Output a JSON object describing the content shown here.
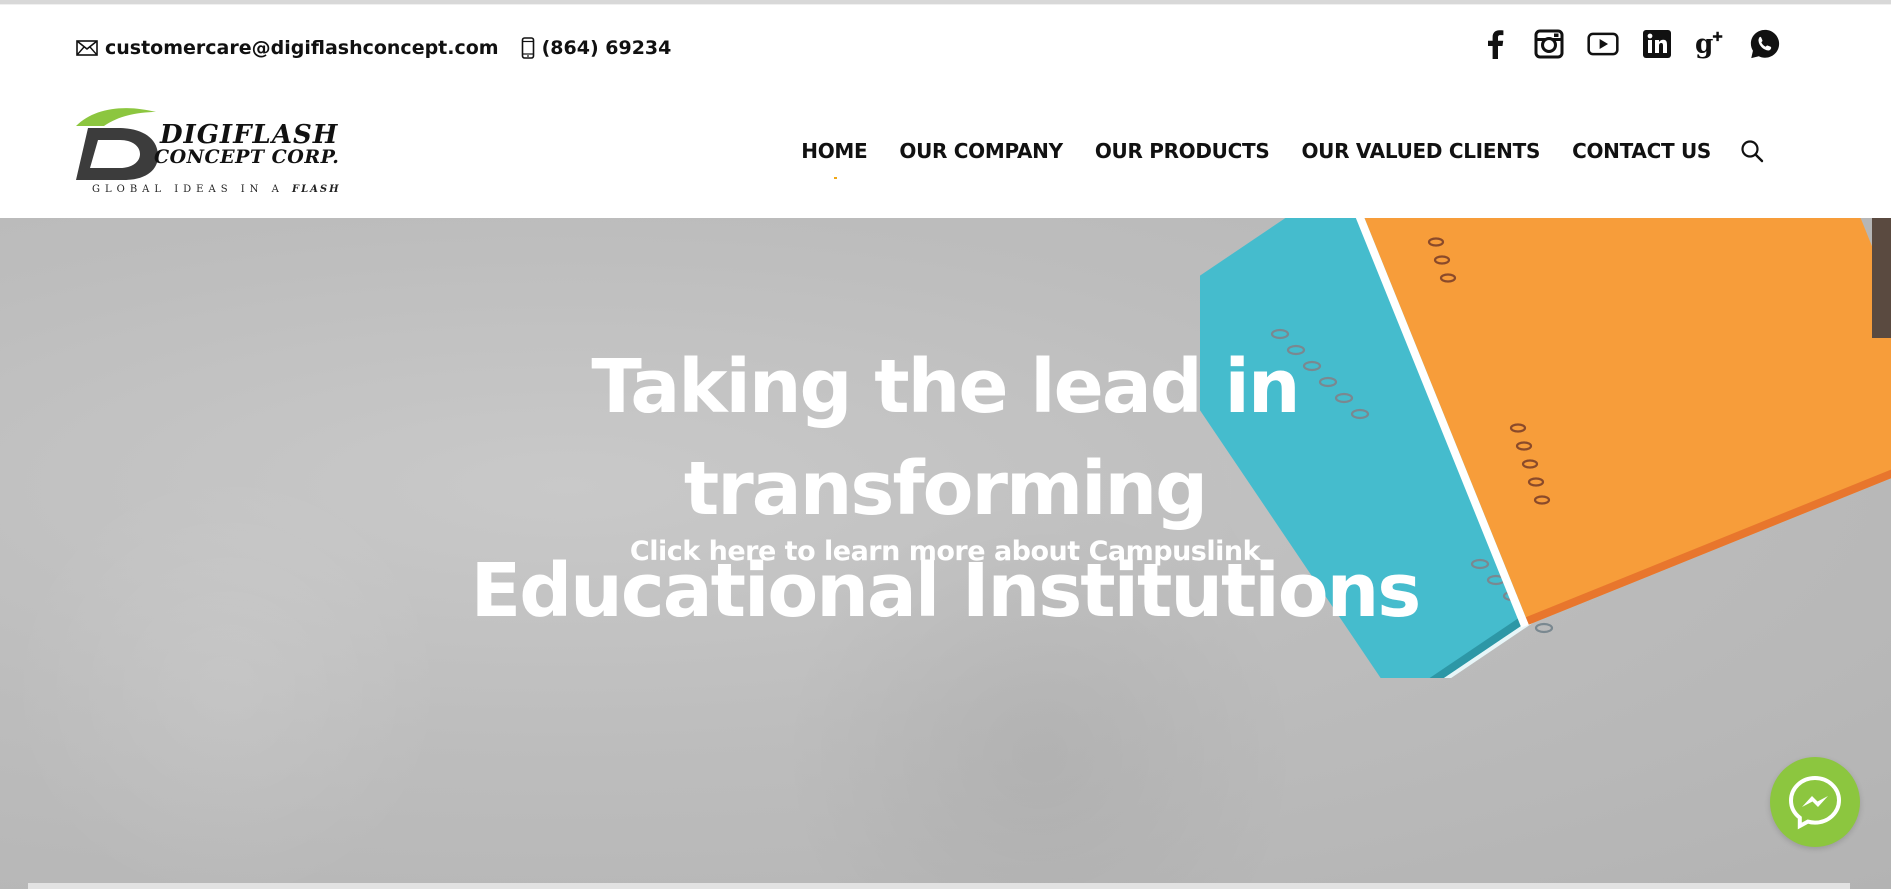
{
  "contact": {
    "email": "customercare@digiflashconcept.com",
    "email_icon": "envelope-icon",
    "phone": "(864) 69234",
    "phone_icon": "mobile-phone-icon"
  },
  "social": [
    {
      "name": "facebook",
      "icon": "facebook-icon"
    },
    {
      "name": "instagram",
      "icon": "instagram-icon"
    },
    {
      "name": "youtube",
      "icon": "youtube-icon"
    },
    {
      "name": "linkedin",
      "icon": "linkedin-icon"
    },
    {
      "name": "google-plus",
      "icon": "google-plus-icon"
    },
    {
      "name": "whatsapp",
      "icon": "whatsapp-icon"
    }
  ],
  "logo": {
    "line1": "DIGIFLASH",
    "line2": "CONCEPT CORP.",
    "tagline": "GLOBAL IDEAS IN A",
    "tagline_emphasis": "FLASH",
    "colors": {
      "green": "#8cc63f",
      "dark": "#3a3a3a"
    }
  },
  "nav": {
    "items": [
      {
        "label": "HOME",
        "active": true
      },
      {
        "label": "OUR COMPANY",
        "active": false
      },
      {
        "label": "OUR PRODUCTS",
        "active": false
      },
      {
        "label": "OUR VALUED CLIENTS",
        "active": false
      },
      {
        "label": "CONTACT US",
        "active": false
      }
    ],
    "search_icon": "search-icon"
  },
  "hero": {
    "title_line1": "Taking the lead in transforming",
    "title_line2": "Educational Institutions",
    "link": "Click here to learn more about Campuslink",
    "notebook_colors": {
      "teal": "#4fc3d2",
      "orange": "#f6a03c"
    }
  },
  "messenger": {
    "icon": "messenger-icon",
    "color": "#8cc63f"
  }
}
